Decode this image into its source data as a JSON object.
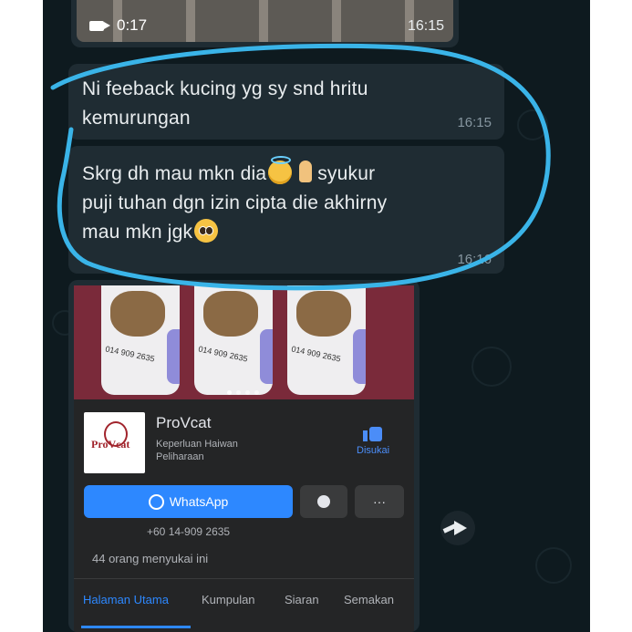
{
  "video_message": {
    "duration": "0:17",
    "time": "16:15"
  },
  "messages": [
    {
      "text_line1": "Ni feeback kucing yg sy snd hritu",
      "text_line2": "kemurungan",
      "time": "16:15"
    },
    {
      "text_line1a": "Skrg dh mau mkn dia",
      "text_line1b": "syukur",
      "text_line2": "puji tuhan dgn izin cipta die akhirny",
      "text_line3": "mau mkn jgk",
      "time": "16:16"
    }
  ],
  "facebook_card": {
    "page_name": "ProVcat",
    "category_line1": "Keperluan Haiwan",
    "category_line2": "Peliharaan",
    "logo_text": "ProVcat",
    "liked_label": "Disukai",
    "whatsapp_label": "WhatsApp",
    "more_label": "···",
    "phone": "+60 14-909 2635",
    "likes_count": "44 orang menyukai ini",
    "tabs": [
      "Halaman Utama",
      "Kumpulan",
      "Siaran",
      "Semakan"
    ],
    "banner_phone": "014 909 2635"
  },
  "colors": {
    "chat_background": "#0e1a1f",
    "bubble": "#1f2c33",
    "annotation": "#3ab4e8",
    "facebook_blue": "#2d88ff"
  },
  "icons": [
    "video-camera-icon",
    "thumbs-up-icon",
    "whatsapp-icon",
    "messenger-icon",
    "forward-icon",
    "smiling-halo-emoji",
    "folded-hands-emoji",
    "pleading-face-emoji"
  ]
}
